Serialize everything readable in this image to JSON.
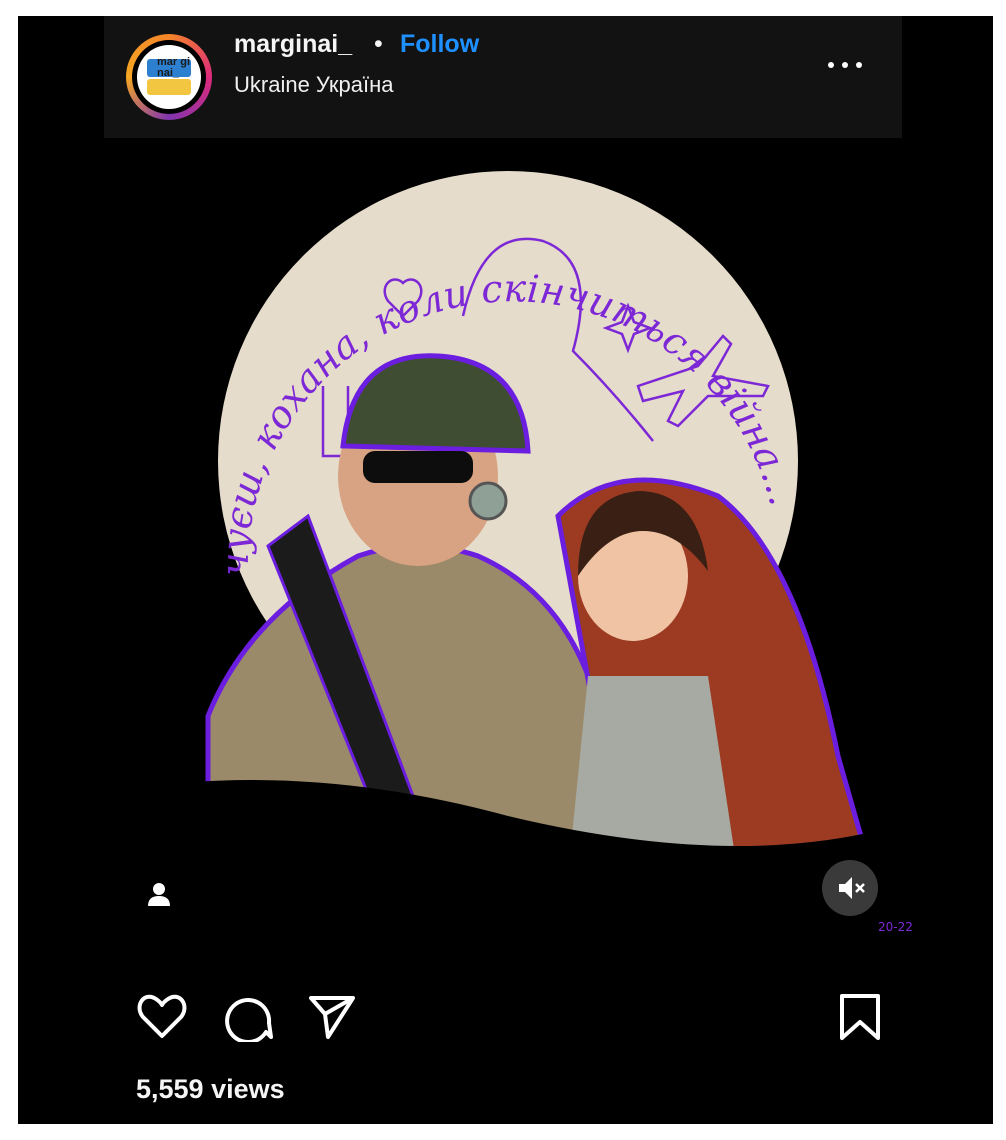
{
  "post": {
    "username": "marginai_",
    "separator": "•",
    "follow_label": "Follow",
    "location": "Ukraine Україна",
    "avatar_text": "mar gi nai_",
    "artwork_caption": "чуєш, кохана, коли скінчиться війна...",
    "artwork_signature": "20-22",
    "views": "5,559 views"
  },
  "icons": {
    "more": "more-horizontal-icon",
    "like": "heart-icon",
    "comment": "comment-icon",
    "share": "send-icon",
    "save": "bookmark-icon",
    "mute": "speaker-muted-icon",
    "tag": "user-tag-icon"
  },
  "colors": {
    "background": "#000000",
    "header": "#121212",
    "follow": "#1e90ff",
    "text": "#f5f5f5",
    "moon": "#e6dccb",
    "accent_purple": "#7d28d6"
  }
}
